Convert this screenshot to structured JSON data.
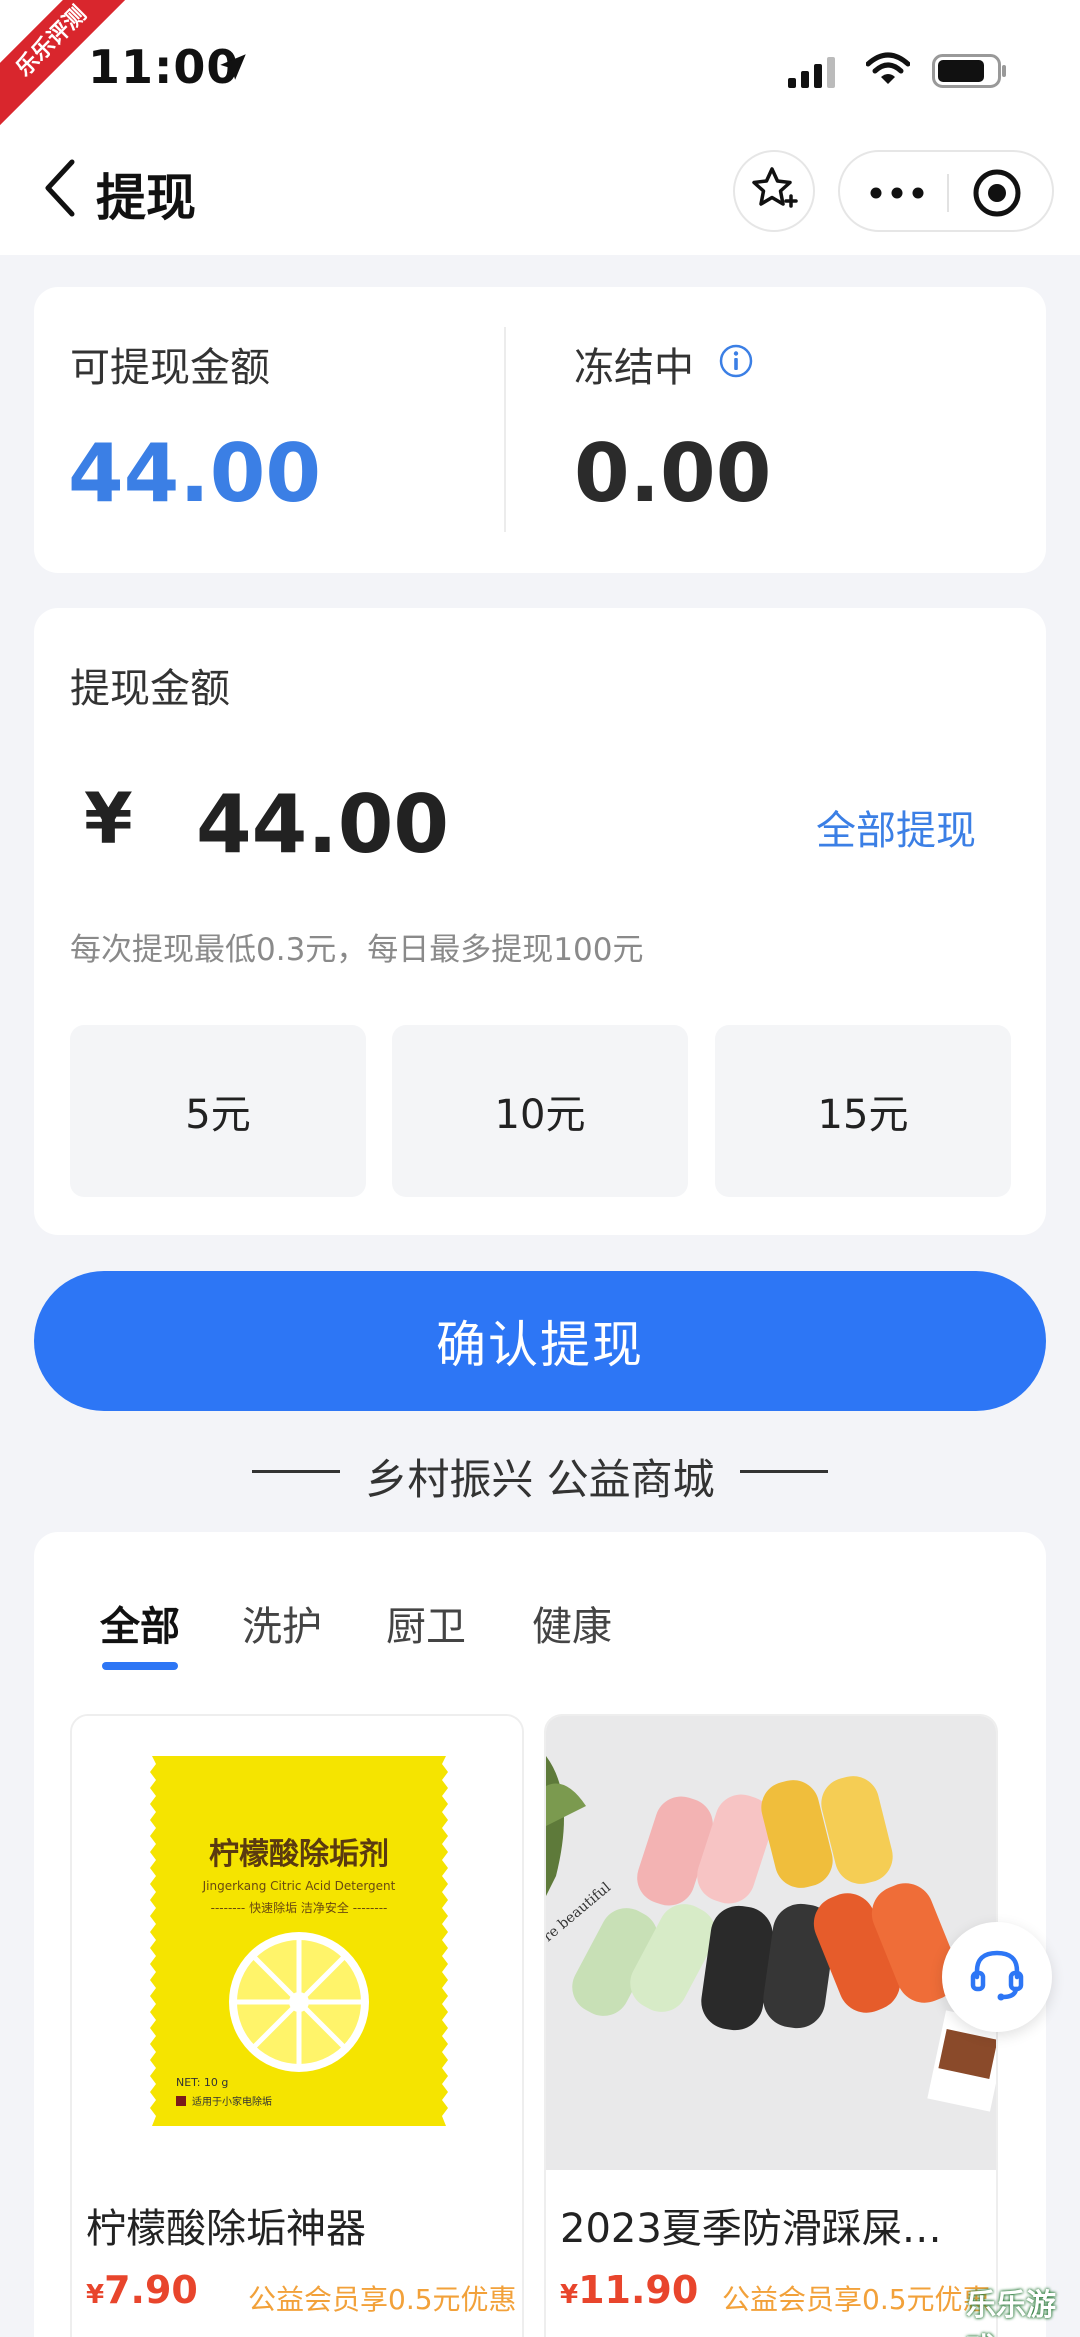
{
  "status_bar": {
    "time": "11:00",
    "ribbon": "乐乐评测"
  },
  "header": {
    "title": "提现"
  },
  "balance": {
    "available_label": "可提现金额",
    "available_value": "44.00",
    "frozen_label": "冻结中",
    "frozen_value": "0.00"
  },
  "withdraw": {
    "label": "提现金额",
    "currency": "¥",
    "amount": "44.00",
    "all_label": "全部提现",
    "hint": "每次提现最低0.3元，每日最多提现100元",
    "quick_options": [
      "5元",
      "10元",
      "15元"
    ],
    "confirm_label": "确认提现"
  },
  "mall": {
    "section_title": "乡村振兴 公益商城",
    "tabs": [
      "全部",
      "洗护",
      "厨卫",
      "健康"
    ],
    "active_tab": 0,
    "products": [
      {
        "name": "柠檬酸除垢神器",
        "currency": "¥",
        "price": "7.90",
        "promo": "公益会员享0.5元优惠",
        "package_title": "柠檬酸除垢剂",
        "package_subtitle": "Jingerkang Citric Acid Detergent",
        "package_tagline": "-------- 快速除垢 洁净安全 --------",
        "package_net": "NET: 10 g",
        "package_note": "适用于小家电除垢"
      },
      {
        "name": "2023夏季防滑踩屎…",
        "currency": "¥",
        "price": "11.90",
        "promo": "公益会员享0.5元优惠",
        "photo_text": "re beautiful"
      }
    ]
  },
  "watermark": "乐乐游戏",
  "colors": {
    "accent": "#2d76f5",
    "available_blue": "#3b7fe5",
    "price_red": "#e8452c",
    "promo_orange": "#f2a13a",
    "background": "#f3f4f8"
  },
  "icons": [
    "location-arrow-icon",
    "signal-icon",
    "wifi-icon",
    "battery-icon",
    "back-chevron-icon",
    "star-plus-icon",
    "more-dots-icon",
    "record-icon",
    "info-icon",
    "customer-service-icon"
  ]
}
